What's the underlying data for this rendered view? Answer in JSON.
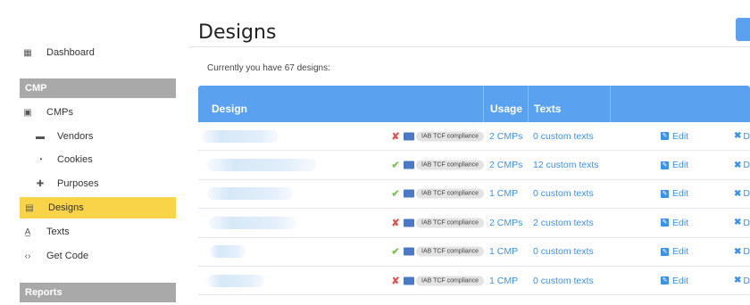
{
  "sidebar": {
    "items": [
      {
        "label": "Dashboard",
        "icon": "dashboard-grid-icon",
        "glyph": "▦"
      },
      {
        "label": "CMPs",
        "icon": "window-icon",
        "glyph": "▣"
      },
      {
        "label": "Vendors",
        "icon": "comment-icon",
        "glyph": "▬"
      },
      {
        "label": "Cookies",
        "icon": "cookie-icon",
        "glyph": "◔"
      },
      {
        "label": "Purposes",
        "icon": "puzzle-icon",
        "glyph": "✚"
      },
      {
        "label": "Designs",
        "icon": "design-icon",
        "glyph": "▤",
        "active": true
      },
      {
        "label": "Texts",
        "icon": "text-icon",
        "glyph": "A̲"
      },
      {
        "label": "Get Code",
        "icon": "code-icon",
        "glyph": "‹›"
      }
    ],
    "sections": {
      "cmp": "CMP",
      "reports": "Reports"
    }
  },
  "main": {
    "title": "Designs",
    "count_text": "Currently you have 67 designs:",
    "columns": {
      "design": "Design",
      "usage": "Usage",
      "texts": "Texts"
    },
    "badge_label": "IAB TCF compliance",
    "edit_label": "Edit",
    "delete_label": "D",
    "rows": [
      {
        "compliant": false,
        "usage": "2 CMPs",
        "texts": "0 custom texts"
      },
      {
        "compliant": true,
        "usage": "2 CMPs",
        "texts": "12 custom texts"
      },
      {
        "compliant": true,
        "usage": "1 CMP",
        "texts": "0 custom texts"
      },
      {
        "compliant": false,
        "usage": "2 CMPs",
        "texts": "2 custom texts"
      },
      {
        "compliant": true,
        "usage": "1 CMP",
        "texts": "0 custom texts"
      },
      {
        "compliant": false,
        "usage": "1 CMP",
        "texts": "0 custom texts"
      }
    ]
  },
  "colors": {
    "accent": "#5aa2f0",
    "active_nav": "#f9d449",
    "link": "#3b92ea",
    "section_head": "#a9a9a9"
  }
}
